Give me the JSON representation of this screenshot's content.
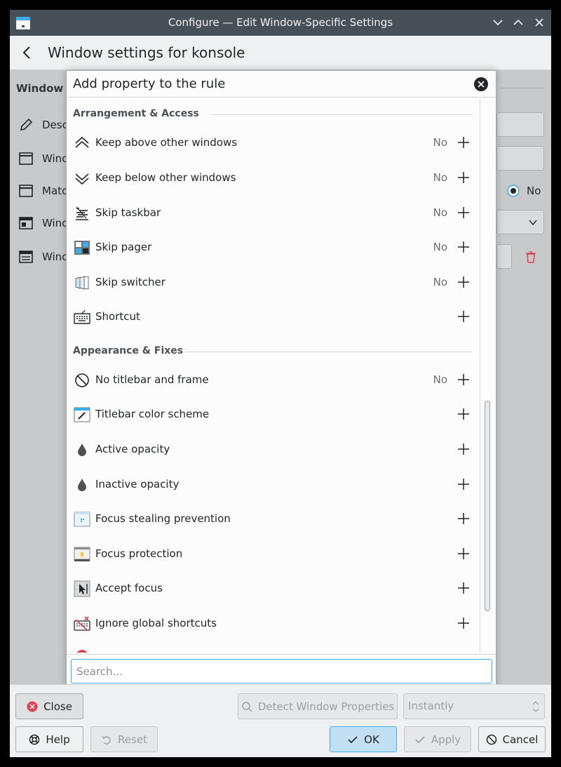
{
  "window": {
    "title": "Configure — Edit Window-Specific Settings"
  },
  "header": {
    "title": "Window settings for konsole"
  },
  "background": {
    "group_title": "Window m",
    "rows": [
      {
        "label": "Desc",
        "icon": "pencil-icon"
      },
      {
        "label": "Winc",
        "icon": "window-icon"
      },
      {
        "label": "Matc",
        "icon": "window-icon"
      },
      {
        "label": "Winc",
        "icon": "window-layout-icon"
      },
      {
        "label": "Winc",
        "icon": "window-list-icon"
      }
    ],
    "radio_label": "No"
  },
  "sheet": {
    "title": "Add property to the rule",
    "sections": [
      {
        "title": "Arrangement & Access",
        "items": [
          {
            "label": "Keep above other windows",
            "value": "No",
            "icon": "keep-above-icon"
          },
          {
            "label": "Keep below other windows",
            "value": "No",
            "icon": "keep-below-icon"
          },
          {
            "label": "Skip taskbar",
            "value": "No",
            "icon": "skip-taskbar-icon"
          },
          {
            "label": "Skip pager",
            "value": "No",
            "icon": "skip-pager-icon"
          },
          {
            "label": "Skip switcher",
            "value": "No",
            "icon": "skip-switcher-icon"
          },
          {
            "label": "Shortcut",
            "value": "",
            "icon": "keyboard-icon"
          }
        ]
      },
      {
        "title": "Appearance & Fixes",
        "items": [
          {
            "label": "No titlebar and frame",
            "value": "No",
            "icon": "no-titlebar-icon"
          },
          {
            "label": "Titlebar color scheme",
            "value": "",
            "icon": "titlebar-color-icon"
          },
          {
            "label": "Active opacity",
            "value": "",
            "icon": "opacity-drop-icon"
          },
          {
            "label": "Inactive opacity",
            "value": "",
            "icon": "opacity-drop-icon"
          },
          {
            "label": "Focus stealing prevention",
            "value": "",
            "icon": "focus-stealing-icon"
          },
          {
            "label": "Focus protection",
            "value": "",
            "icon": "focus-protection-icon"
          },
          {
            "label": "Accept focus",
            "value": "",
            "icon": "accept-focus-icon"
          },
          {
            "label": "Ignore global shortcuts",
            "value": "",
            "icon": "ignore-shortcuts-icon"
          }
        ]
      }
    ],
    "search_placeholder": "Search..."
  },
  "buttons": {
    "close": "Close",
    "detect": "Detect Window Properties",
    "delay": "Instantly",
    "help": "Help",
    "reset": "Reset",
    "ok": "OK",
    "apply": "Apply",
    "cancel": "Cancel"
  },
  "colors": {
    "accent": "#3daee9",
    "titlebar": "#475057",
    "danger": "#da4453"
  }
}
